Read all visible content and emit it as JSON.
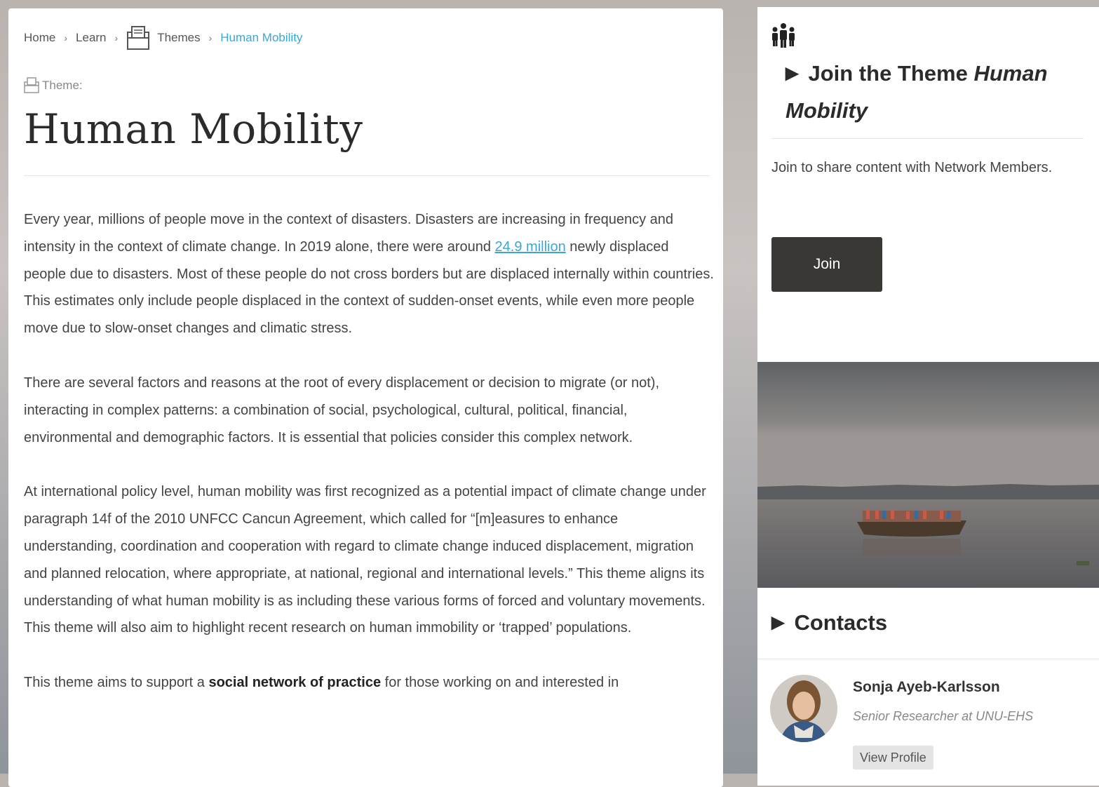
{
  "breadcrumb": {
    "home": "Home",
    "learn": "Learn",
    "themes": "Themes",
    "current": "Human Mobility",
    "separator": "›",
    "themes_icon": "themes-folder-icon"
  },
  "page": {
    "kicker": "Theme:",
    "kicker_icon": "theme-folder-icon",
    "title": "Human Mobility"
  },
  "content": {
    "p1_a": "Every year, millions of people move in the context of disasters. Disasters are increasing in frequency and intensity in the context of climate change. In 2019 alone, there were around ",
    "p1_link": "24.9 million",
    "p1_b": " newly displaced people due to disasters. Most of these people do not cross borders but are displaced internally within countries. This estimates only include people displaced in the context of sudden-onset events, while even more people move due to slow-onset changes and climatic stress.",
    "p2": "There are several factors and reasons at the root of every displacement or decision to migrate (or not), interacting in complex patterns: a combination of social, psychological, cultural, political, financial, environmental and demographic factors. It is essential that policies consider this complex network.",
    "p3": "At international policy level, human mobility was first recognized as a potential impact of climate change under paragraph 14f of the 2010 UNFCC Cancun Agreement, which called for “[m]easures to enhance understanding, coordination and cooperation with regard to climate change induced displacement, migration and planned relocation, where appropriate, at national, regional and international levels.” This theme aligns its understanding of what human mobility is as including these various forms of forced and voluntary movements. This theme will also aim to highlight recent research on human immobility or ‘trapped’ populations.",
    "p4_a": "This theme aims to support a ",
    "p4_strong": "social network of practice",
    "p4_b": " for those working on and interested in"
  },
  "sidebar": {
    "people_icon": "people-group-icon",
    "join_heading_prefix": "Join the Theme ",
    "join_heading_theme": "Human Mobility",
    "join_description": "Join to share content with Network Members.",
    "join_button": "Join",
    "contacts_heading": "Contacts",
    "contact": {
      "name": "Sonja Ayeb-Karlsson",
      "role": "Senior Researcher at UNU-EHS",
      "view_profile": "View Profile"
    }
  },
  "colors": {
    "link": "#3aa7d6",
    "button_dark": "#393835",
    "heading": "#2b2b2b",
    "body_text": "#444444"
  }
}
